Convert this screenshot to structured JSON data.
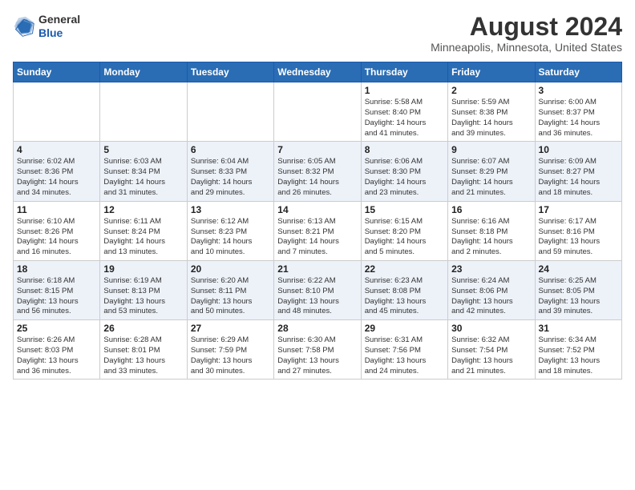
{
  "header": {
    "logo_line1": "General",
    "logo_line2": "Blue",
    "month_year": "August 2024",
    "location": "Minneapolis, Minnesota, United States"
  },
  "weekdays": [
    "Sunday",
    "Monday",
    "Tuesday",
    "Wednesday",
    "Thursday",
    "Friday",
    "Saturday"
  ],
  "weeks": [
    [
      {
        "day": "",
        "info": ""
      },
      {
        "day": "",
        "info": ""
      },
      {
        "day": "",
        "info": ""
      },
      {
        "day": "",
        "info": ""
      },
      {
        "day": "1",
        "info": "Sunrise: 5:58 AM\nSunset: 8:40 PM\nDaylight: 14 hours\nand 41 minutes."
      },
      {
        "day": "2",
        "info": "Sunrise: 5:59 AM\nSunset: 8:38 PM\nDaylight: 14 hours\nand 39 minutes."
      },
      {
        "day": "3",
        "info": "Sunrise: 6:00 AM\nSunset: 8:37 PM\nDaylight: 14 hours\nand 36 minutes."
      }
    ],
    [
      {
        "day": "4",
        "info": "Sunrise: 6:02 AM\nSunset: 8:36 PM\nDaylight: 14 hours\nand 34 minutes."
      },
      {
        "day": "5",
        "info": "Sunrise: 6:03 AM\nSunset: 8:34 PM\nDaylight: 14 hours\nand 31 minutes."
      },
      {
        "day": "6",
        "info": "Sunrise: 6:04 AM\nSunset: 8:33 PM\nDaylight: 14 hours\nand 29 minutes."
      },
      {
        "day": "7",
        "info": "Sunrise: 6:05 AM\nSunset: 8:32 PM\nDaylight: 14 hours\nand 26 minutes."
      },
      {
        "day": "8",
        "info": "Sunrise: 6:06 AM\nSunset: 8:30 PM\nDaylight: 14 hours\nand 23 minutes."
      },
      {
        "day": "9",
        "info": "Sunrise: 6:07 AM\nSunset: 8:29 PM\nDaylight: 14 hours\nand 21 minutes."
      },
      {
        "day": "10",
        "info": "Sunrise: 6:09 AM\nSunset: 8:27 PM\nDaylight: 14 hours\nand 18 minutes."
      }
    ],
    [
      {
        "day": "11",
        "info": "Sunrise: 6:10 AM\nSunset: 8:26 PM\nDaylight: 14 hours\nand 16 minutes."
      },
      {
        "day": "12",
        "info": "Sunrise: 6:11 AM\nSunset: 8:24 PM\nDaylight: 14 hours\nand 13 minutes."
      },
      {
        "day": "13",
        "info": "Sunrise: 6:12 AM\nSunset: 8:23 PM\nDaylight: 14 hours\nand 10 minutes."
      },
      {
        "day": "14",
        "info": "Sunrise: 6:13 AM\nSunset: 8:21 PM\nDaylight: 14 hours\nand 7 minutes."
      },
      {
        "day": "15",
        "info": "Sunrise: 6:15 AM\nSunset: 8:20 PM\nDaylight: 14 hours\nand 5 minutes."
      },
      {
        "day": "16",
        "info": "Sunrise: 6:16 AM\nSunset: 8:18 PM\nDaylight: 14 hours\nand 2 minutes."
      },
      {
        "day": "17",
        "info": "Sunrise: 6:17 AM\nSunset: 8:16 PM\nDaylight: 13 hours\nand 59 minutes."
      }
    ],
    [
      {
        "day": "18",
        "info": "Sunrise: 6:18 AM\nSunset: 8:15 PM\nDaylight: 13 hours\nand 56 minutes."
      },
      {
        "day": "19",
        "info": "Sunrise: 6:19 AM\nSunset: 8:13 PM\nDaylight: 13 hours\nand 53 minutes."
      },
      {
        "day": "20",
        "info": "Sunrise: 6:20 AM\nSunset: 8:11 PM\nDaylight: 13 hours\nand 50 minutes."
      },
      {
        "day": "21",
        "info": "Sunrise: 6:22 AM\nSunset: 8:10 PM\nDaylight: 13 hours\nand 48 minutes."
      },
      {
        "day": "22",
        "info": "Sunrise: 6:23 AM\nSunset: 8:08 PM\nDaylight: 13 hours\nand 45 minutes."
      },
      {
        "day": "23",
        "info": "Sunrise: 6:24 AM\nSunset: 8:06 PM\nDaylight: 13 hours\nand 42 minutes."
      },
      {
        "day": "24",
        "info": "Sunrise: 6:25 AM\nSunset: 8:05 PM\nDaylight: 13 hours\nand 39 minutes."
      }
    ],
    [
      {
        "day": "25",
        "info": "Sunrise: 6:26 AM\nSunset: 8:03 PM\nDaylight: 13 hours\nand 36 minutes."
      },
      {
        "day": "26",
        "info": "Sunrise: 6:28 AM\nSunset: 8:01 PM\nDaylight: 13 hours\nand 33 minutes."
      },
      {
        "day": "27",
        "info": "Sunrise: 6:29 AM\nSunset: 7:59 PM\nDaylight: 13 hours\nand 30 minutes."
      },
      {
        "day": "28",
        "info": "Sunrise: 6:30 AM\nSunset: 7:58 PM\nDaylight: 13 hours\nand 27 minutes."
      },
      {
        "day": "29",
        "info": "Sunrise: 6:31 AM\nSunset: 7:56 PM\nDaylight: 13 hours\nand 24 minutes."
      },
      {
        "day": "30",
        "info": "Sunrise: 6:32 AM\nSunset: 7:54 PM\nDaylight: 13 hours\nand 21 minutes."
      },
      {
        "day": "31",
        "info": "Sunrise: 6:34 AM\nSunset: 7:52 PM\nDaylight: 13 hours\nand 18 minutes."
      }
    ]
  ]
}
